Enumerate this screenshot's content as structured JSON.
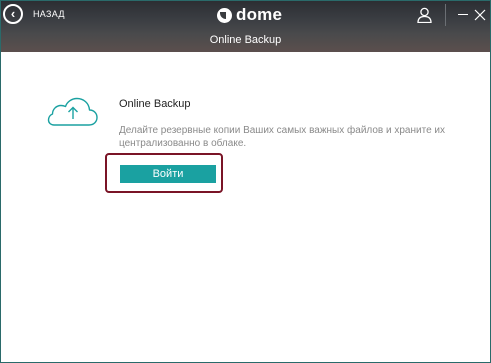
{
  "header": {
    "back_label": "НАЗАД",
    "brand": "dome",
    "section_title": "Online Backup"
  },
  "icons": {
    "back": "chevron-left-icon",
    "user": "user-icon",
    "minimize": "minimize-icon",
    "close": "close-icon",
    "cloud": "cloud-upload-icon"
  },
  "main": {
    "title": "Online Backup",
    "description": "Делайте резервные копии Ваших самых важных файлов и храните их централизованно в облаке.",
    "login_label": "Войти"
  },
  "colors": {
    "accent": "#1aa1a1",
    "highlight": "#7a1426"
  }
}
